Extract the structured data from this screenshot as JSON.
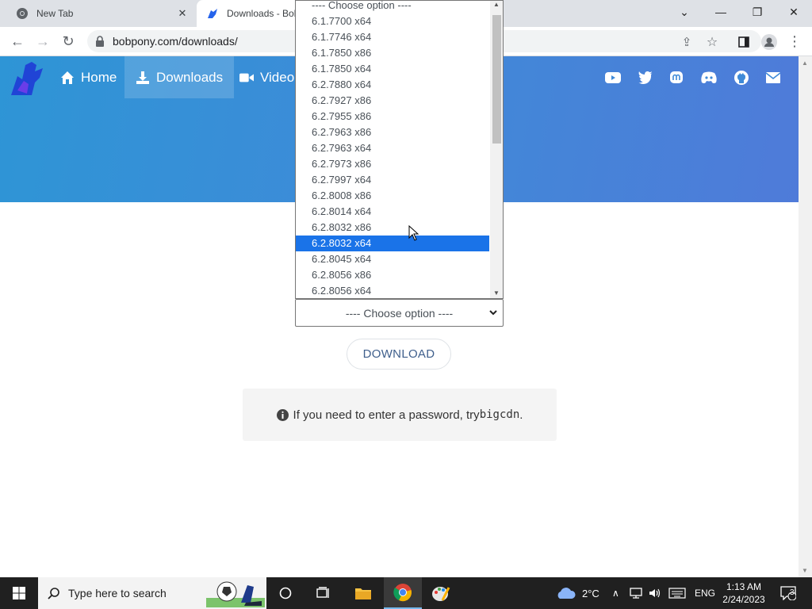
{
  "browser": {
    "tabs": [
      {
        "label": "New Tab"
      },
      {
        "label": "Downloads - Bob"
      }
    ],
    "url": "bobpony.com/downloads/"
  },
  "site": {
    "nav": [
      {
        "label": "Home"
      },
      {
        "label": "Downloads"
      },
      {
        "label": "Video"
      }
    ],
    "select_value": "---- Choose option ----",
    "download_label": "DOWNLOAD",
    "info_text": "If you need to enter a password, try ",
    "info_code": "bigcdn",
    "info_end": "."
  },
  "dropdown": {
    "options": [
      "---- Choose option ----",
      "6.1.7700 x64",
      "6.1.7746 x64",
      "6.1.7850 x86",
      "6.1.7850 x64",
      "6.2.7880 x64",
      "6.2.7927 x86",
      "6.2.7955 x86",
      "6.2.7963 x86",
      "6.2.7963 x64",
      "6.2.7973 x86",
      "6.2.7997 x64",
      "6.2.8008 x86",
      "6.2.8014 x64",
      "6.2.8032 x86",
      "6.2.8032 x64",
      "6.2.8045 x64",
      "6.2.8056 x86",
      "6.2.8056 x64"
    ],
    "highlighted": "6.2.8032 x64"
  },
  "taskbar": {
    "search_placeholder": "Type here to search",
    "weather": "2°C",
    "language": "ENG",
    "time": "1:13 AM",
    "date": "2/24/2023",
    "notifications": "3"
  },
  "colors": {
    "hero_start": "#2e95d6",
    "hero_end": "#4f7bd9",
    "selection": "#1a73e8"
  }
}
